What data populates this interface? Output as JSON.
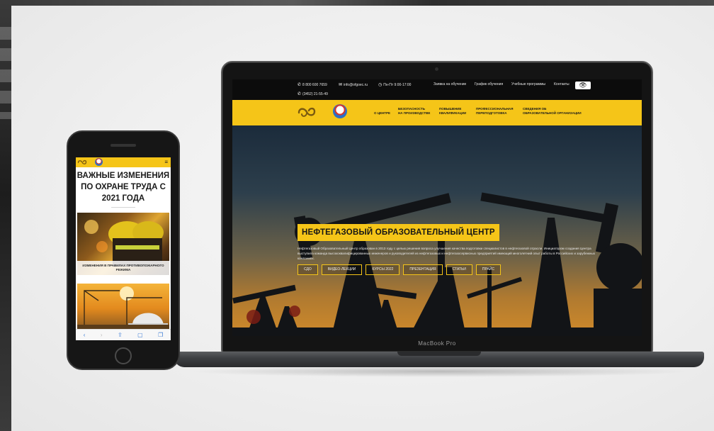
{
  "laptop": {
    "model_label": "MacBook Pro",
    "topbar": {
      "phone1": "8 800 600 7659",
      "email": "info@ofgoec.ru",
      "hours": "Пн-Пт 9:00-17:00",
      "phone2": "(3452) 21-55-49",
      "links": [
        "Заявка на обучение",
        "График обучения",
        "Учебные программы",
        "Контакты"
      ]
    },
    "nav": [
      {
        "line1": "",
        "line2": "О центре"
      },
      {
        "line1": "Безопасность",
        "line2": "на производстве"
      },
      {
        "line1": "Повышение",
        "line2": "квалификации"
      },
      {
        "line1": "Профессиональная",
        "line2": "переподготовка"
      },
      {
        "line1": "Сведения об",
        "line2": "образовательной организации"
      }
    ],
    "hero": {
      "title": "Нефтегазовый Образовательный Центр",
      "description": "Нефтегазовый Образовательный Центр образован в 2013 году с целью решения вопроса улучшения качества подготовки специалистов в нефтегазовой отрасли. Инициатором создания Центра выступила команда высококвалифицированных инженеров и руководителей из нефтегазовых и нефтегазосервисных предприятий имеющий многолетний опыт работы в Российских и зарубежных компаниях.",
      "buttons": [
        "СДО",
        "Видео-лекции",
        "Курсы 2022",
        "Презентация",
        "Статьи",
        "Прайс"
      ]
    }
  },
  "phone": {
    "heading": "Важные изменения по охране труда с 2021 года",
    "card1_label": "Изменения в правилах противопожарного режима",
    "toolbar_icons": [
      "back-icon",
      "forward-icon",
      "share-icon",
      "book-icon",
      "tabs-icon"
    ]
  },
  "colors": {
    "brand_yellow": "#f5c518",
    "topbar_dark": "#0c0c0c",
    "stage_bg": "#efefef"
  }
}
